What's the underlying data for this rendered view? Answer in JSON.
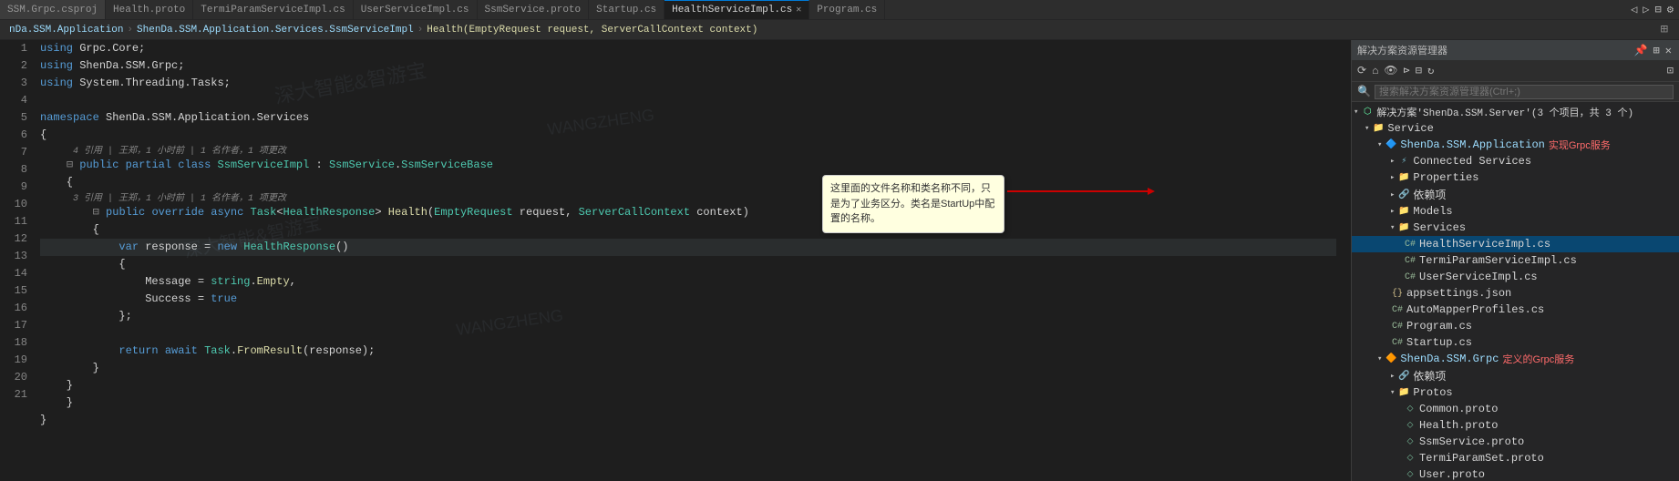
{
  "tabs": [
    {
      "id": "ssm-grpc-csproj",
      "label": "SSM.Grpc.csproj",
      "active": false,
      "closable": false
    },
    {
      "id": "health-proto",
      "label": "Health.proto",
      "active": false,
      "closable": false
    },
    {
      "id": "termi-param-service-impl",
      "label": "TermiParamServiceImpl.cs",
      "active": false,
      "closable": false
    },
    {
      "id": "user-service-impl",
      "label": "UserServiceImpl.cs",
      "active": false,
      "closable": false
    },
    {
      "id": "ssm-service-proto",
      "label": "SsmService.proto",
      "active": false,
      "closable": false
    },
    {
      "id": "startup",
      "label": "Startup.cs",
      "active": false,
      "closable": false
    },
    {
      "id": "health-service-impl",
      "label": "HealthServiceImpl.cs",
      "active": true,
      "closable": true
    },
    {
      "id": "program",
      "label": "Program.cs",
      "active": false,
      "closable": false
    }
  ],
  "breadcrumb": {
    "left": "nDa.SSM.Application",
    "middle": "ShenDa.SSM.Application.Services.SsmServiceImpl",
    "right": "Health(EmptyRequest request, ServerCallContext context)"
  },
  "code": {
    "lines": [
      {
        "num": 1,
        "content": "using Grpc.Core;",
        "tokens": [
          {
            "t": "kw",
            "v": "using"
          },
          {
            "t": "plain",
            "v": " Grpc.Core;"
          }
        ]
      },
      {
        "num": 2,
        "content": "using ShenDa.SSM.Grpc;",
        "tokens": [
          {
            "t": "kw",
            "v": "using"
          },
          {
            "t": "plain",
            "v": " ShenDa.SSM.Grpc;"
          }
        ]
      },
      {
        "num": 3,
        "content": "using System.Threading.Tasks;",
        "tokens": [
          {
            "t": "kw",
            "v": "using"
          },
          {
            "t": "plain",
            "v": " System.Threading.Tasks;"
          }
        ]
      },
      {
        "num": 4,
        "content": ""
      },
      {
        "num": 5,
        "content": "namespace ShenDa.SSM.Application.Services",
        "tokens": [
          {
            "t": "kw",
            "v": "namespace"
          },
          {
            "t": "plain",
            "v": " ShenDa.SSM.Application.Services"
          }
        ]
      },
      {
        "num": 6,
        "content": "{"
      },
      {
        "num": 7,
        "content": "    public partial class SsmServiceImpl : SsmService.SsmServiceBase",
        "tokens": []
      },
      {
        "num": 8,
        "content": "    {"
      },
      {
        "num": 9,
        "content": "        public override async Task<HealthResponse> Health(EmptyRequest request, ServerCallContext context)",
        "tokens": []
      },
      {
        "num": 10,
        "content": "        {"
      },
      {
        "num": 11,
        "content": "            var response = new HealthResponse()",
        "tokens": []
      },
      {
        "num": 12,
        "content": "            {"
      },
      {
        "num": 13,
        "content": "                Message = string.Empty,",
        "tokens": []
      },
      {
        "num": 14,
        "content": "                Success = true",
        "tokens": []
      },
      {
        "num": 15,
        "content": "            };"
      },
      {
        "num": 16,
        "content": ""
      },
      {
        "num": 17,
        "content": "            return await Task.FromResult(response);",
        "tokens": []
      },
      {
        "num": 18,
        "content": "        }"
      },
      {
        "num": 19,
        "content": "    }"
      },
      {
        "num": 20,
        "content": "    }"
      },
      {
        "num": 21,
        "content": "}"
      }
    ],
    "ref_comment_7": "4 引用 | 王郑，1 小时前 | 1 名作者，1 项更改",
    "ref_comment_9": "3 引用 | 王郑，1 小时前 | 1 名作者，1 项更改"
  },
  "annotation": {
    "text": "这里面的文件名称和类名称不同，只是为了业务区分。类名是StartUp中配置的名称。",
    "arrow_label": ""
  },
  "solution_explorer": {
    "title": "解决方案资源管理器",
    "search_placeholder": "搜索解决方案资源管理器(Ctrl+;)",
    "solution_label": "解决方案'ShenDa.SSM.Server'(3个项目，共3个)",
    "tree": [
      {
        "id": "solution",
        "level": 0,
        "icon": "solution",
        "label": "解决方案'ShenDa.SSM.Server'(3 个项目，共 3 个)",
        "expanded": true,
        "type": "solution"
      },
      {
        "id": "service-folder",
        "level": 1,
        "icon": "folder",
        "label": "Service",
        "expanded": true,
        "type": "folder"
      },
      {
        "id": "shenda-ssm-application",
        "level": 2,
        "icon": "project",
        "label": "ShenDa.SSM.Application",
        "expanded": true,
        "type": "project",
        "annotation": "实现Grpc服务"
      },
      {
        "id": "connected-services",
        "level": 3,
        "icon": "connected",
        "label": "Connected Services",
        "expanded": false,
        "type": "folder"
      },
      {
        "id": "properties",
        "level": 3,
        "icon": "folder",
        "label": "Properties",
        "expanded": false,
        "type": "folder"
      },
      {
        "id": "依赖项-app",
        "level": 3,
        "icon": "deps",
        "label": "依赖项",
        "expanded": false,
        "type": "folder"
      },
      {
        "id": "models",
        "level": 3,
        "icon": "folder",
        "label": "Models",
        "expanded": false,
        "type": "folder"
      },
      {
        "id": "services-folder",
        "level": 3,
        "icon": "folder",
        "label": "Services",
        "expanded": true,
        "type": "folder"
      },
      {
        "id": "health-service-impl-cs",
        "level": 4,
        "icon": "cs",
        "label": "HealthServiceImpl.cs",
        "expanded": false,
        "type": "cs",
        "selected": true
      },
      {
        "id": "termi-param-service-impl-cs",
        "level": 4,
        "icon": "cs",
        "label": "TermiParamServiceImpl.cs",
        "expanded": false,
        "type": "cs"
      },
      {
        "id": "user-service-impl-cs",
        "level": 4,
        "icon": "cs",
        "label": "UserServiceImpl.cs",
        "expanded": false,
        "type": "cs"
      },
      {
        "id": "appsettings-json",
        "level": 3,
        "icon": "json",
        "label": "appsettings.json",
        "expanded": false,
        "type": "json"
      },
      {
        "id": "automapper-profiles-cs",
        "level": 3,
        "icon": "cs",
        "label": "AutoMapperProfiles.cs",
        "expanded": false,
        "type": "cs"
      },
      {
        "id": "program-cs",
        "level": 3,
        "icon": "cs",
        "label": "Program.cs",
        "expanded": false,
        "type": "cs"
      },
      {
        "id": "startup-cs",
        "level": 3,
        "icon": "cs",
        "label": "Startup.cs",
        "expanded": false,
        "type": "cs"
      },
      {
        "id": "shenda-ssm-grpc",
        "level": 2,
        "icon": "project",
        "label": "ShenDa.SSM.Grpc",
        "expanded": true,
        "type": "project",
        "annotation": "定义的Grpc服务"
      },
      {
        "id": "依赖项-grpc",
        "level": 3,
        "icon": "deps",
        "label": "依赖项",
        "expanded": false,
        "type": "folder"
      },
      {
        "id": "protos-folder",
        "level": 3,
        "icon": "folder",
        "label": "Protos",
        "expanded": true,
        "type": "folder"
      },
      {
        "id": "common-proto",
        "level": 4,
        "icon": "proto",
        "label": "Common.proto",
        "expanded": false,
        "type": "proto"
      },
      {
        "id": "health-proto-file",
        "level": 4,
        "icon": "proto",
        "label": "Health.proto",
        "expanded": false,
        "type": "proto"
      },
      {
        "id": "ssm-service-proto-file",
        "level": 4,
        "icon": "proto",
        "label": "SsmService.proto",
        "expanded": false,
        "type": "proto"
      },
      {
        "id": "termi-param-set-proto",
        "level": 4,
        "icon": "proto",
        "label": "TermiParamSet.proto",
        "expanded": false,
        "type": "proto"
      },
      {
        "id": "user-proto",
        "level": 4,
        "icon": "proto",
        "label": "User.proto",
        "expanded": false,
        "type": "proto"
      }
    ]
  },
  "labels": {
    "grpc_impl_label": "实现Grpc服务",
    "grpc_def_label": "定义的Grpc服务",
    "common_proto": "Common proto",
    "health_proto": "Health proto",
    "connected_services": "Connected Services",
    "services": "Services"
  }
}
